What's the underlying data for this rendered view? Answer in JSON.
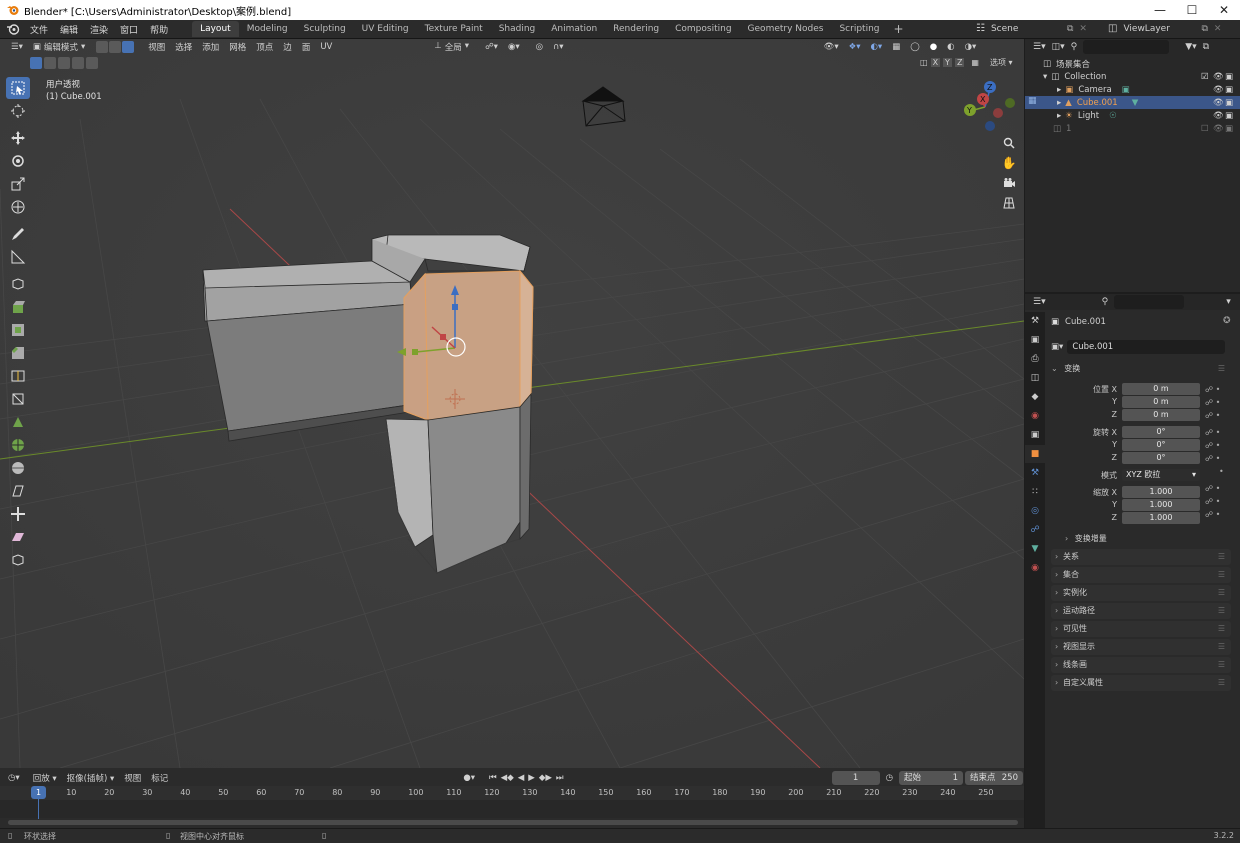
{
  "window": {
    "title": "Blender* [C:\\Users\\Administrator\\Desktop\\案例.blend]",
    "controls": [
      "minimize-icon",
      "maximize-icon",
      "close-icon"
    ]
  },
  "topbar": {
    "menus": [
      "文件",
      "编辑",
      "渲染",
      "窗口",
      "帮助"
    ],
    "workspaces": [
      "Layout",
      "Modeling",
      "Sculpting",
      "UV Editing",
      "Texture Paint",
      "Shading",
      "Animation",
      "Rendering",
      "Compositing",
      "Geometry Nodes",
      "Scripting"
    ],
    "active_workspace": "Layout",
    "add_workspace": "+",
    "scene": "Scene",
    "view_layer": "ViewLayer"
  },
  "viewport": {
    "mode": "编辑模式",
    "menus": [
      "视图",
      "选择",
      "添加",
      "网格",
      "顶点",
      "边",
      "面",
      "UV"
    ],
    "orientation": "全局",
    "options": "选项",
    "axes": [
      "X",
      "Y",
      "Z"
    ],
    "view_name": "用户透视",
    "object_name": "(1) Cube.001",
    "gizmo_axes": [
      "X",
      "Y",
      "Z"
    ]
  },
  "outliner": {
    "root": "场景集合",
    "items": [
      {
        "label": "Collection",
        "selected": false
      },
      {
        "label": "Camera",
        "selected": false
      },
      {
        "label": "Cube.001",
        "selected": true
      },
      {
        "label": "Light",
        "selected": false
      },
      {
        "label": "1",
        "selected": false
      }
    ]
  },
  "properties": {
    "object_name": "Cube.001",
    "data_name": "Cube.001",
    "transform_header": "变换",
    "location_label": "位置 X",
    "rotation_label": "旋转 X",
    "scale_label": "缩放 X",
    "axis_y": "Y",
    "axis_z": "Z",
    "location": [
      "0 m",
      "0 m",
      "0 m"
    ],
    "rotation": [
      "0°",
      "0°",
      "0°"
    ],
    "mode_label": "模式",
    "rotation_mode": "XYZ 欧拉",
    "scale": [
      "1.000",
      "1.000",
      "1.000"
    ],
    "delta": "变换增量",
    "panels": [
      "关系",
      "集合",
      "实例化",
      "运动路径",
      "可见性",
      "视图显示",
      "线条画",
      "自定义属性"
    ]
  },
  "timeline": {
    "menus": [
      "回放",
      "抠像(插帧)",
      "视图",
      "标记"
    ],
    "current_frame": "1",
    "start_label": "起始",
    "start": "1",
    "end_label": "结束点",
    "end": "250",
    "ticks": [
      "10",
      "20",
      "30",
      "40",
      "50",
      "60",
      "70",
      "80",
      "90",
      "100",
      "110",
      "120",
      "130",
      "140",
      "150",
      "160",
      "170",
      "180",
      "190",
      "200",
      "210",
      "220",
      "230",
      "240",
      "250"
    ],
    "playhead": "1"
  },
  "statusbar": {
    "left": "环状选择",
    "middle": "视图中心对齐鼠标",
    "version": "3.2.2"
  },
  "colors": {
    "accent": "#4772b3",
    "selected_face": "#e09a64",
    "x_axis": "#c04545",
    "y_axis": "#7ea12c",
    "active_text": "#f0a050"
  }
}
